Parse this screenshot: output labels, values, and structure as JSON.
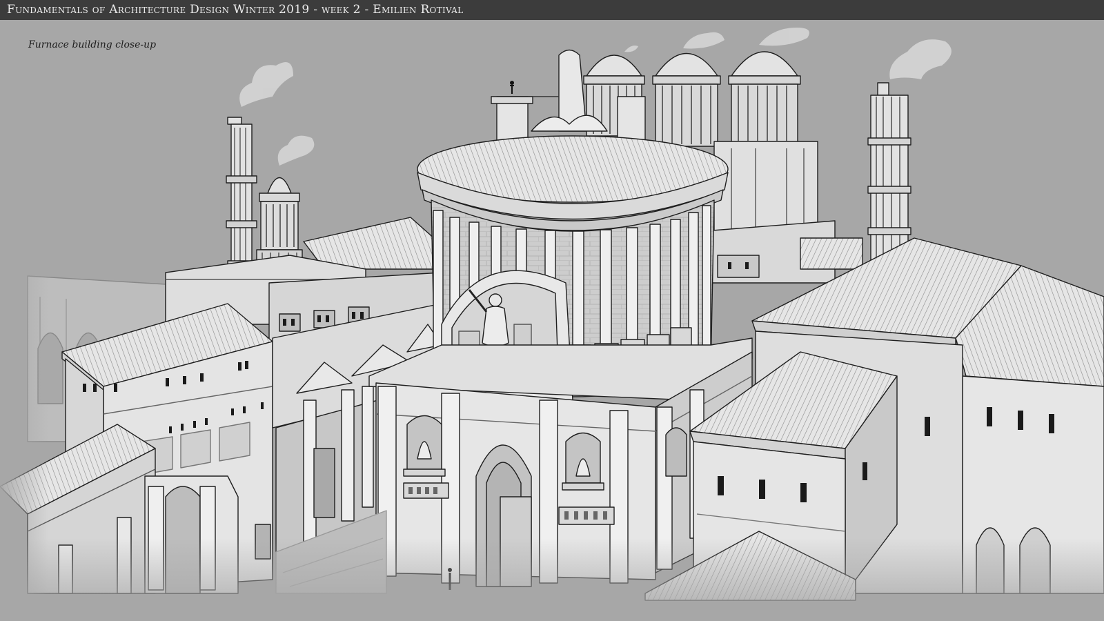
{
  "header": {
    "title": "Fundamentals of Architecture Design Winter 2019 - week 2 - Emilien Rotival"
  },
  "caption": "Furnace building close-up",
  "colors": {
    "background": "#a7a7a7",
    "title_bar": "#3c3c3c",
    "title_text": "#ececec",
    "wall_light": "#e2e2e2",
    "wall_shade": "#c4c4c4",
    "line": "#1f1f1f"
  }
}
